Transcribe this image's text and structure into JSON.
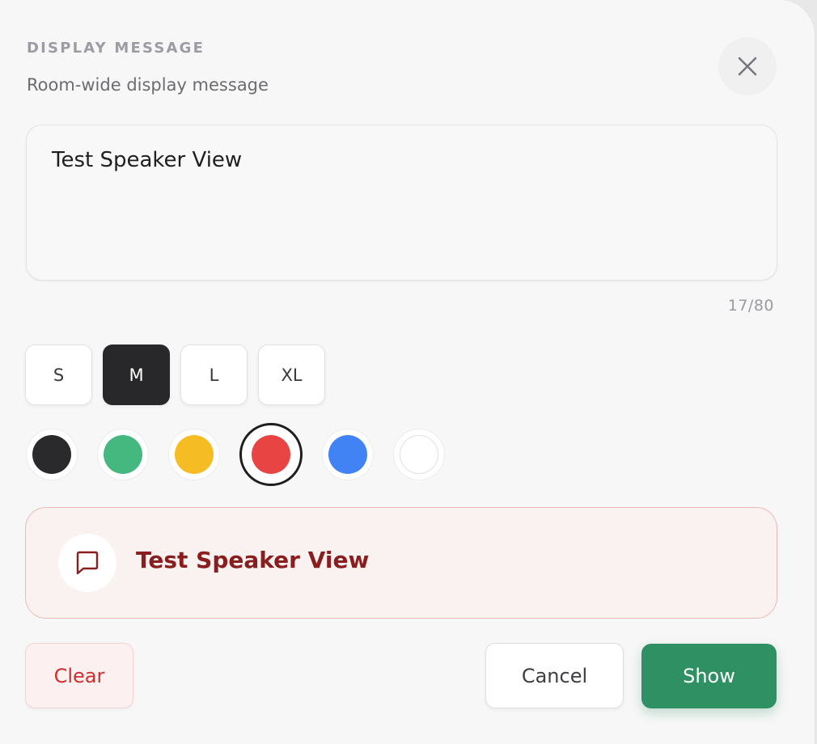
{
  "header": {
    "eyebrow": "DISPLAY MESSAGE",
    "subtitle": "Room-wide display message"
  },
  "message": {
    "value": "Test Speaker View",
    "counter": "17/80"
  },
  "sizes": [
    {
      "label": "S",
      "active": false
    },
    {
      "label": "M",
      "active": true
    },
    {
      "label": "L",
      "active": false
    },
    {
      "label": "XL",
      "active": false
    }
  ],
  "colors": [
    {
      "name": "black",
      "hex": "#2a2a2d",
      "selected": false
    },
    {
      "name": "green",
      "hex": "#45b880",
      "selected": false
    },
    {
      "name": "yellow",
      "hex": "#f5bd23",
      "selected": false
    },
    {
      "name": "red",
      "hex": "#e84444",
      "selected": true
    },
    {
      "name": "blue",
      "hex": "#4183f5",
      "selected": false
    },
    {
      "name": "white",
      "hex": "#ffffff",
      "selected": false
    }
  ],
  "preview": {
    "text": "Test Speaker View",
    "icon": "chat-bubble-icon"
  },
  "actions": {
    "clear_label": "Clear",
    "cancel_label": "Cancel",
    "show_label": "Show"
  },
  "icons": {
    "close": "close-icon"
  }
}
